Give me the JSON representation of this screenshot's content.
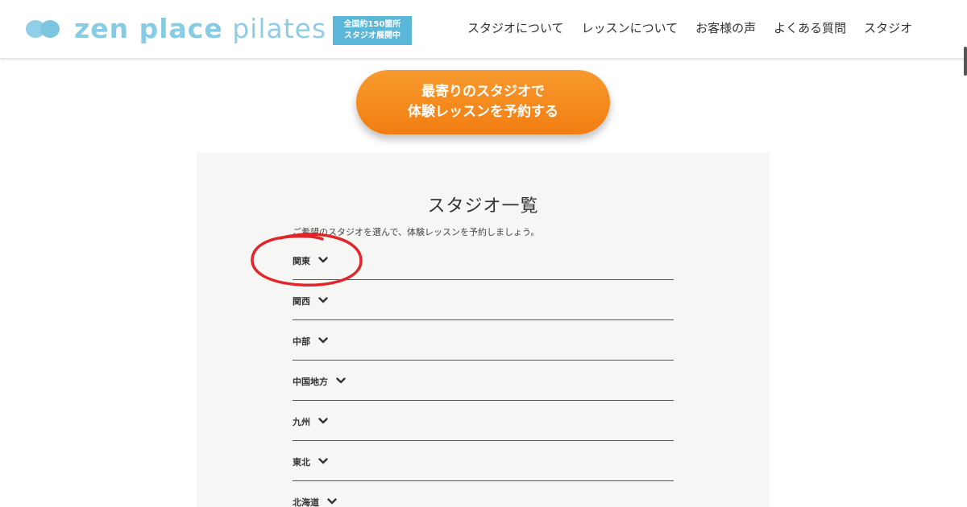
{
  "header": {
    "logo": {
      "mark_icon": "double-circle-logo-icon",
      "text_bold": "zen place",
      "text_light": " pilates"
    },
    "badge": {
      "line1": "全国約150箇所",
      "line2": "スタジオ展開中"
    },
    "nav": [
      {
        "label": "スタジオについて"
      },
      {
        "label": "レッスンについて"
      },
      {
        "label": "お客様の声"
      },
      {
        "label": "よくある質問"
      },
      {
        "label": "スタジオ"
      }
    ]
  },
  "cta": {
    "line1": "最寄りのスタジオで",
    "line2": "体験レッスンを予約する",
    "color_start": "#f79a2e",
    "color_end": "#f27d11"
  },
  "studio_list": {
    "title": "スタジオ一覧",
    "description": "ご希望のスタジオを選んで、体験レッスンを予約しましょう。",
    "regions": [
      {
        "label": "関東",
        "icon": "chevron-down-icon"
      },
      {
        "label": "関西",
        "icon": "chevron-down-icon"
      },
      {
        "label": "中部",
        "icon": "chevron-down-icon"
      },
      {
        "label": "中国地方",
        "icon": "chevron-down-icon"
      },
      {
        "label": "九州",
        "icon": "chevron-down-icon"
      },
      {
        "label": "東北",
        "icon": "chevron-down-icon"
      },
      {
        "label": "北海道",
        "icon": "chevron-down-icon"
      }
    ]
  },
  "annotation": {
    "shape": "red-ellipse",
    "color": "#e0262b"
  },
  "colors": {
    "brand_blue": "#88cbe4",
    "badge_blue": "#5ab7d8",
    "cta_orange": "#f5871f",
    "panel_bg": "#f6f6f4"
  }
}
